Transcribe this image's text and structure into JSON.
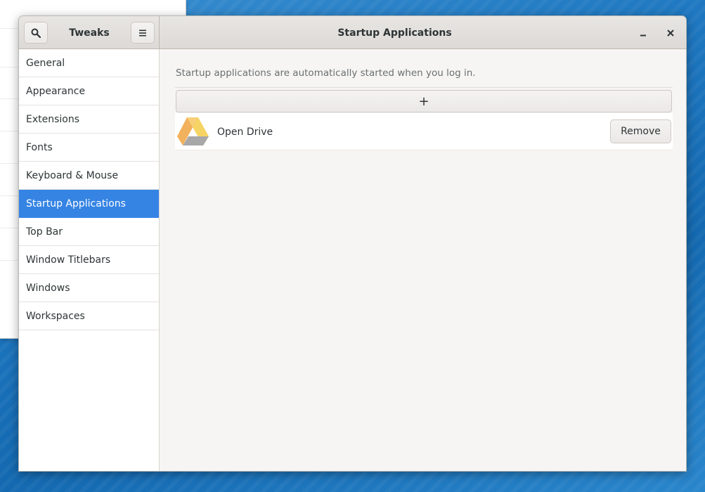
{
  "headerbar": {
    "app_title": "Tweaks",
    "page_title": "Startup Applications",
    "search_icon": "search-icon",
    "menu_icon": "hamburger-menu-icon",
    "minimize_icon": "minimize-icon",
    "close_icon": "close-icon"
  },
  "sidebar": {
    "items": [
      {
        "label": "General"
      },
      {
        "label": "Appearance"
      },
      {
        "label": "Extensions"
      },
      {
        "label": "Fonts"
      },
      {
        "label": "Keyboard & Mouse"
      },
      {
        "label": "Startup Applications",
        "selected": true
      },
      {
        "label": "Top Bar"
      },
      {
        "label": "Window Titlebars"
      },
      {
        "label": "Windows"
      },
      {
        "label": "Workspaces"
      }
    ],
    "selected_color": "#3584e4"
  },
  "content": {
    "description": "Startup applications are automatically started when you log in.",
    "add_button_label": "+",
    "apps": [
      {
        "name": "Open Drive",
        "icon": "google-drive-icon",
        "remove_label": "Remove"
      }
    ]
  }
}
